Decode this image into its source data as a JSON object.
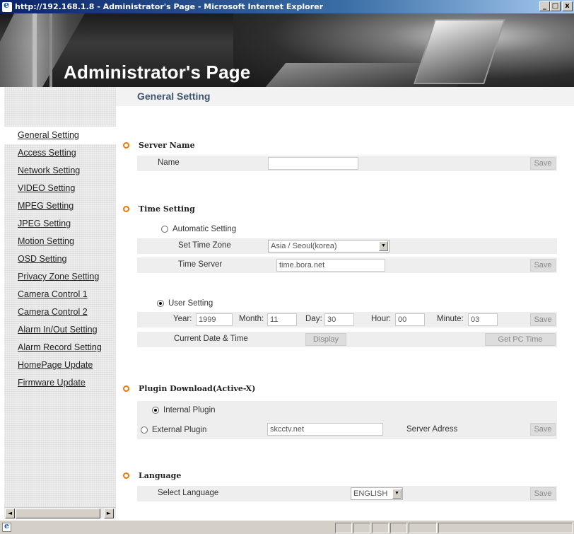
{
  "window": {
    "title": "http://192.168.1.8 - Administrator's Page - Microsoft Internet Explorer",
    "controls": [
      "_",
      "□",
      "x"
    ]
  },
  "header": {
    "title": "Administrator's Page"
  },
  "sidebar": {
    "items": [
      {
        "label": "General Setting",
        "active": true
      },
      {
        "label": "Access Setting"
      },
      {
        "label": "Network Setting"
      },
      {
        "label": "VIDEO Setting"
      },
      {
        "label": "MPEG Setting"
      },
      {
        "label": "JPEG Setting"
      },
      {
        "label": "Motion Setting"
      },
      {
        "label": "OSD Setting"
      },
      {
        "label": "Privacy Zone Setting"
      },
      {
        "label": "Camera Control 1"
      },
      {
        "label": "Camera Control 2"
      },
      {
        "label": "Alarm In/Out Setting"
      },
      {
        "label": "Alarm Record Setting"
      },
      {
        "label": "HomePage Update"
      },
      {
        "label": "Firmware Update"
      }
    ]
  },
  "main": {
    "page_title": "General Setting",
    "server_name": {
      "heading": "Server Name",
      "name_label": "Name",
      "name_value": "",
      "save_label": "Save"
    },
    "time_setting": {
      "heading": "Time Setting",
      "automatic_label": "Automatic Setting",
      "automatic_selected": false,
      "time_zone_label": "Set Time Zone",
      "time_zone_value": "Asia / Seoul(korea)",
      "time_server_label": "Time Server",
      "time_server_value": "time.bora.net",
      "auto_save_label": "Save",
      "user_label": "User Setting",
      "user_selected": true,
      "year_label": "Year:",
      "year_value": "1999",
      "month_label": "Month:",
      "month_value": "11",
      "day_label": "Day:",
      "day_value": "30",
      "hour_label": "Hour:",
      "hour_value": "00",
      "minute_label": "Minute:",
      "minute_value": "03",
      "user_save_label": "Save",
      "current_label": "Current Date & Time",
      "display_label": "Display",
      "get_pc_time_label": "Get PC Time"
    },
    "plugin": {
      "heading": "Plugin Download(Active-X)",
      "internal_label": "Internal Plugin",
      "internal_selected": true,
      "external_label": "External Plugin",
      "external_selected": false,
      "server_value": "skcctv.net",
      "server_label": "Server Adress",
      "save_label": "Save"
    },
    "language": {
      "heading": "Language",
      "select_label": "Select Language",
      "select_value": "ENGLISH",
      "save_label": "Save"
    }
  },
  "scrollbar": {
    "left_arrow": "◄",
    "right_arrow": "►"
  }
}
